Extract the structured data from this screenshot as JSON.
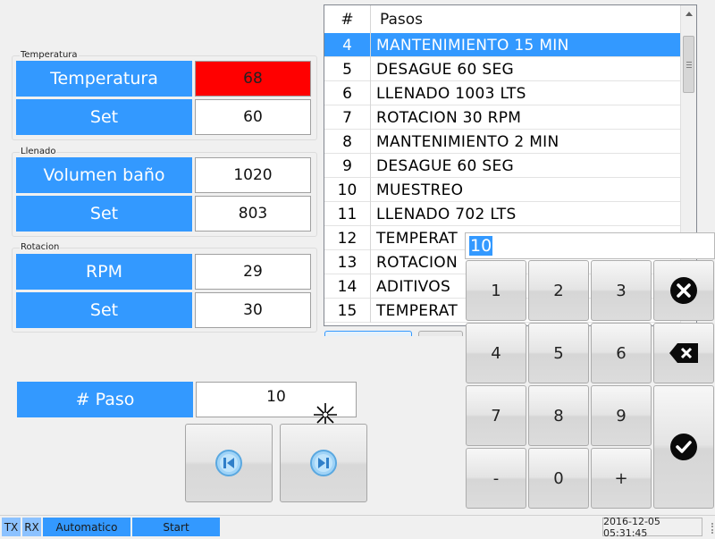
{
  "groups": {
    "temperatura": {
      "title": "Temperatura",
      "rows": [
        {
          "label": "Temperatura",
          "value": "68",
          "value_bg": "#ff0000"
        },
        {
          "label": "Set",
          "value": "60"
        }
      ]
    },
    "llenado": {
      "title": "Llenado",
      "rows": [
        {
          "label": "Volumen baño",
          "value": "1020"
        },
        {
          "label": "Set",
          "value": "803"
        }
      ]
    },
    "rotacion": {
      "title": "Rotacion",
      "rows": [
        {
          "label": "RPM",
          "value": "29"
        },
        {
          "label": "Set",
          "value": "30"
        }
      ]
    }
  },
  "paso": {
    "label": "# Paso",
    "value": "10"
  },
  "steps": {
    "headers": [
      "#",
      "Pasos"
    ],
    "rows": [
      {
        "n": "4",
        "t": "MANTENIMIENTO 15 MIN",
        "selected": true
      },
      {
        "n": "5",
        "t": "DESAGUE 60 SEG"
      },
      {
        "n": "6",
        "t": "LLENADO 1003 LTS"
      },
      {
        "n": "7",
        "t": "ROTACION 30 RPM"
      },
      {
        "n": "8",
        "t": "MANTENIMIENTO 2 MIN"
      },
      {
        "n": "9",
        "t": "DESAGUE 60 SEG"
      },
      {
        "n": "10",
        "t": "MUESTREO"
      },
      {
        "n": "11",
        "t": "LLENADO 702 LTS"
      },
      {
        "n": "12",
        "t": "TEMPERAT"
      },
      {
        "n": "13",
        "t": "ROTACION"
      },
      {
        "n": "14",
        "t": "ADITIVOS"
      },
      {
        "n": "15",
        "t": "TEMPERAT"
      }
    ]
  },
  "keypad": {
    "input_value": "10",
    "keys": [
      "1",
      "2",
      "3",
      "4",
      "5",
      "6",
      "7",
      "8",
      "9",
      "-",
      "0",
      "+"
    ]
  },
  "statusbar": {
    "tx": "TX",
    "rx": "RX",
    "mode": "Automatico",
    "start": "Start",
    "datetime": "2016-12-05 05:31:45"
  },
  "colors": {
    "accent": "#3399ff",
    "alarm": "#ff0000",
    "selected_row": "#3399ff"
  },
  "icons": [
    "first-step-icon",
    "last-step-icon",
    "clear-icon",
    "backspace-icon",
    "confirm-icon",
    "scroll-up-icon"
  ]
}
